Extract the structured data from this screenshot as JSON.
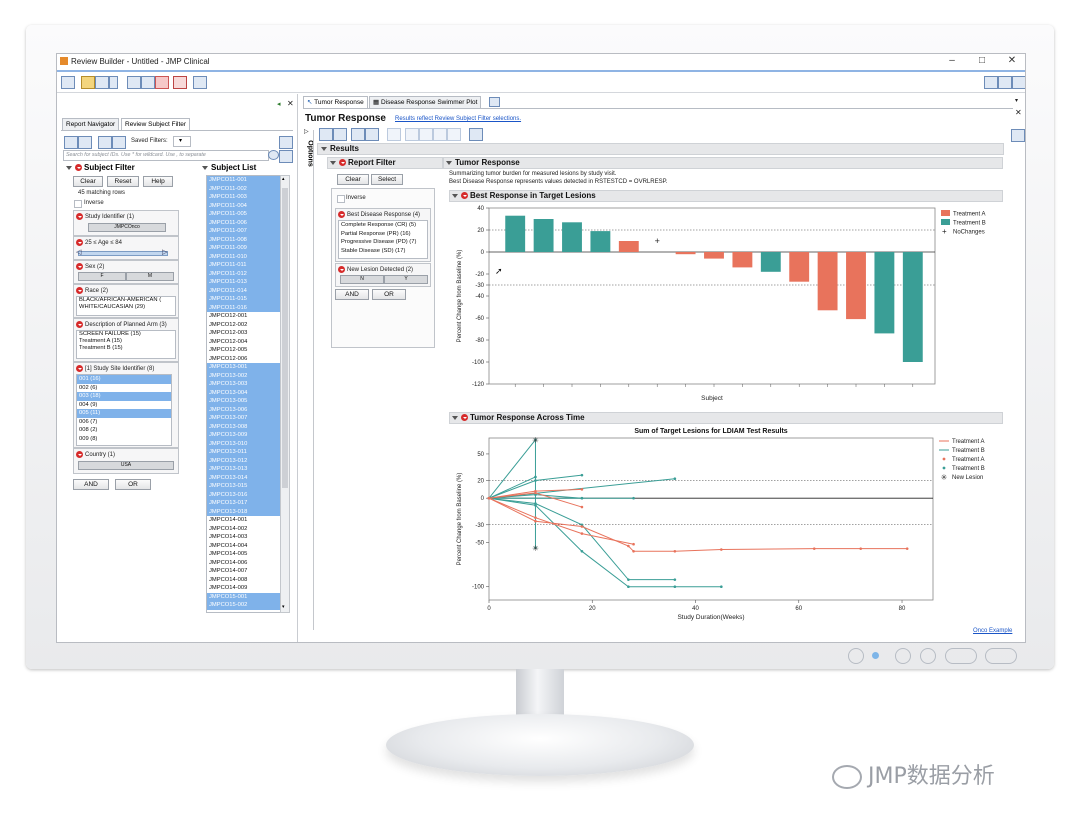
{
  "window": {
    "title": "Review Builder - Untitled - JMP Clinical",
    "controls": [
      "–",
      "□",
      "✕"
    ]
  },
  "left_panel": {
    "tabs": [
      {
        "label": "Report Navigator"
      },
      {
        "label": "Review Subject Filter"
      }
    ],
    "saved_filters_label": "Saved Filters:",
    "search_placeholder": "Search for subject IDs. Use * for wildcard. Use , to separate",
    "subject_filter": {
      "title": "Subject Filter",
      "buttons": {
        "clear": "Clear",
        "reset": "Reset",
        "help": "Help"
      },
      "matching": "45 matching rows",
      "inverse": "Inverse",
      "groups": [
        {
          "title": "Study Identifier (1)",
          "chip": "JMPCOnco"
        },
        {
          "title": "25 ≤ Age ≤ 84"
        },
        {
          "title": "Sex (2)",
          "chips": [
            "F",
            "M"
          ]
        },
        {
          "title": "Race (2)",
          "items": [
            "BLACK/AFRICAN-AMERICAN (",
            "WHITE/CAUCASIAN (29)"
          ]
        },
        {
          "title": "Description of Planned Arm (3)",
          "items": [
            "SCREEN FAILURE (15)",
            "Treatment A (15)",
            "Treatment B (15)"
          ]
        },
        {
          "title": "[1] Study Site Identifier (8)",
          "items": [
            "001 (16)",
            "002 (6)",
            "003 (18)",
            "004 (9)",
            "005 (11)",
            "006 (7)",
            "008 (2)",
            "009 (8)"
          ],
          "selected": [
            0,
            2,
            4
          ]
        },
        {
          "title": "Country (1)",
          "chip": "USA"
        }
      ],
      "and": "AND",
      "or": "OR"
    },
    "subject_list": {
      "title": "Subject List",
      "items": [
        "JMPCO11-001",
        "JMPCO11-002",
        "JMPCO11-003",
        "JMPCO11-004",
        "JMPCO11-005",
        "JMPCO11-006",
        "JMPCO11-007",
        "JMPCO11-008",
        "JMPCO11-009",
        "JMPCO11-010",
        "JMPCO11-011",
        "JMPCO11-012",
        "JMPCO11-013",
        "JMPCO11-014",
        "JMPCO11-015",
        "JMPCO11-016",
        "JMPCO12-001",
        "JMPCO12-002",
        "JMPCO12-003",
        "JMPCO12-004",
        "JMPCO12-005",
        "JMPCO12-006",
        "JMPCO13-001",
        "JMPCO13-002",
        "JMPCO13-003",
        "JMPCO13-004",
        "JMPCO13-005",
        "JMPCO13-006",
        "JMPCO13-007",
        "JMPCO13-008",
        "JMPCO13-009",
        "JMPCO13-010",
        "JMPCO13-011",
        "JMPCO13-012",
        "JMPCO13-013",
        "JMPCO13-014",
        "JMPCO13-015",
        "JMPCO13-016",
        "JMPCO13-017",
        "JMPCO13-018",
        "JMPCO14-001",
        "JMPCO14-002",
        "JMPCO14-003",
        "JMPCO14-004",
        "JMPCO14-005",
        "JMPCO14-006",
        "JMPCO14-007",
        "JMPCO14-008",
        "JMPCO14-009",
        "JMPCO15-001",
        "JMPCO15-002"
      ],
      "selected_ranges": [
        [
          0,
          15
        ],
        [
          22,
          39
        ],
        [
          49,
          50
        ]
      ]
    }
  },
  "right_panel": {
    "tabs": [
      {
        "label": "Tumor Response"
      },
      {
        "label": "Disease Response Swimmer Plot"
      }
    ],
    "title": "Tumor Response",
    "title_link": "Results reflect Review Subject Filter selections.",
    "options_label": "Options",
    "results": "Results",
    "report_filter": {
      "title": "Report Filter",
      "buttons": {
        "clear": "Clear",
        "select": "Select"
      },
      "inverse": "Inverse",
      "best_response": {
        "title": "Best Disease Response (4)",
        "items": [
          "Complete Response (CR) (5)",
          "Partial Response (PR) (16)",
          "Progressive Disease (PD) (7)",
          "Stable Disease (SD) (17)"
        ]
      },
      "new_lesion": {
        "title": "New Lesion Detected (2)",
        "chips": [
          "N",
          "Y"
        ]
      },
      "and": "AND",
      "or": "OR"
    },
    "tumor_response": {
      "title": "Tumor Response",
      "desc1": "Summarizing tumor burden for measured lesions by study visit.",
      "desc2": "Best Disease Response represents values detected in RSTESTCD = OVRLRESP."
    },
    "footer_link": "Onco Example"
  },
  "colors": {
    "treatment_a": "#e8735c",
    "treatment_b": "#3a9e96",
    "selection": "#7fb2ea",
    "link": "#1a55c7"
  },
  "chart_data": [
    {
      "type": "bar",
      "title": "Best Response in Target Lesions",
      "xlabel": "Subject",
      "ylabel": "Percent Change from Baseline (%)",
      "ylim": [
        -120,
        40
      ],
      "yticks": [
        40,
        20,
        0,
        -20,
        -30,
        -40,
        -60,
        -80,
        -100,
        -120
      ],
      "reference_lines": [
        20,
        -30
      ],
      "legend": {
        "position": "right",
        "entries": [
          "Treatment A",
          "Treatment B",
          "NoChanges"
        ]
      },
      "bars": [
        {
          "group": "Treatment B",
          "value": 33
        },
        {
          "group": "Treatment B",
          "value": 30
        },
        {
          "group": "Treatment B",
          "value": 27
        },
        {
          "group": "Treatment B",
          "value": 19
        },
        {
          "group": "Treatment A",
          "value": 10
        },
        {
          "group": "NoChanges",
          "value": 0
        },
        {
          "group": "Treatment A",
          "value": -2
        },
        {
          "group": "Treatment A",
          "value": -6
        },
        {
          "group": "Treatment A",
          "value": -14
        },
        {
          "group": "Treatment B",
          "value": -18
        },
        {
          "group": "Treatment A",
          "value": -27
        },
        {
          "group": "Treatment A",
          "value": -53
        },
        {
          "group": "Treatment A",
          "value": -61
        },
        {
          "group": "Treatment B",
          "value": -74
        },
        {
          "group": "Treatment B",
          "value": -100
        }
      ]
    },
    {
      "type": "line",
      "section": "Tumor Response Across Time",
      "title": "Sum of Target Lesions for LDIAM Test Results",
      "xlabel": "Study Duration(Weeks)",
      "ylabel": "Percent Change from Baseline (%)",
      "xlim": [
        0,
        86
      ],
      "ylim": [
        -115,
        68
      ],
      "xticks": [
        0,
        20,
        40,
        60,
        80
      ],
      "yticks": [
        50,
        20,
        0,
        -30,
        -50,
        -100
      ],
      "reference_lines": [
        20,
        0,
        -30
      ],
      "legend": {
        "position": "right",
        "entries": [
          "Treatment A",
          "Treatment B",
          "Treatment A",
          "Treatment B",
          "New Lesion"
        ]
      },
      "series": [
        {
          "group": "Treatment B",
          "points": [
            [
              0,
              0
            ],
            [
              9,
              66
            ],
            [
              9,
              -56
            ]
          ]
        },
        {
          "group": "Treatment B",
          "points": [
            [
              0,
              0
            ],
            [
              9,
              20
            ],
            [
              18,
              26
            ]
          ]
        },
        {
          "group": "Treatment B",
          "points": [
            [
              0,
              0
            ],
            [
              9,
              24
            ]
          ]
        },
        {
          "group": "Treatment B",
          "points": [
            [
              0,
              0
            ],
            [
              9,
              4
            ],
            [
              18,
              0
            ]
          ]
        },
        {
          "group": "Treatment B",
          "points": [
            [
              0,
              0
            ],
            [
              18,
              0
            ],
            [
              28,
              0
            ]
          ]
        },
        {
          "group": "Treatment B",
          "points": [
            [
              0,
              0
            ],
            [
              36,
              22
            ]
          ]
        },
        {
          "group": "Treatment B",
          "points": [
            [
              0,
              0
            ],
            [
              9,
              -8
            ],
            [
              18,
              -60
            ],
            [
              27,
              -100
            ],
            [
              36,
              -100
            ],
            [
              45,
              -100
            ]
          ]
        },
        {
          "group": "Treatment B",
          "points": [
            [
              0,
              0
            ],
            [
              9,
              -6
            ],
            [
              18,
              -30
            ],
            [
              27,
              -92
            ],
            [
              36,
              -92
            ]
          ]
        },
        {
          "group": "Treatment A",
          "points": [
            [
              0,
              0
            ],
            [
              9,
              8
            ],
            [
              18,
              10
            ]
          ]
        },
        {
          "group": "Treatment A",
          "points": [
            [
              0,
              0
            ],
            [
              9,
              6
            ],
            [
              18,
              -10
            ]
          ]
        },
        {
          "group": "Treatment A",
          "points": [
            [
              0,
              0
            ],
            [
              9,
              -26
            ],
            [
              18,
              -32
            ],
            [
              27,
              -54
            ],
            [
              28,
              -60
            ],
            [
              36,
              -60
            ],
            [
              45,
              -58
            ],
            [
              63,
              -57
            ],
            [
              72,
              -57
            ],
            [
              81,
              -57
            ]
          ]
        },
        {
          "group": "Treatment A",
          "points": [
            [
              0,
              0
            ],
            [
              9,
              -22
            ],
            [
              18,
              -40
            ],
            [
              28,
              -52
            ]
          ]
        }
      ],
      "new_lesion_points": [
        [
          9,
          66
        ],
        [
          9,
          -56
        ]
      ]
    }
  ]
}
